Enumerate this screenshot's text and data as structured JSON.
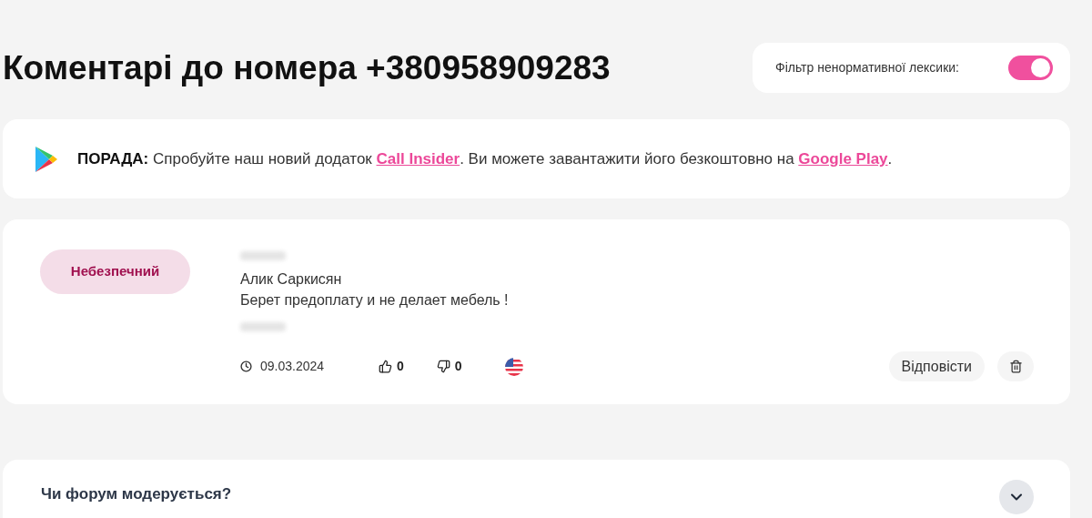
{
  "heading": "Коментарі до номера +380958909283",
  "filter": {
    "label": "Фільтр ненормативної лексики:",
    "on": true
  },
  "tip": {
    "label": "ПОРАДА:",
    "parts": [
      {
        "kind": "text",
        "text": " Спробуйте наш новий додаток "
      },
      {
        "kind": "link",
        "text": "Call Insider"
      },
      {
        "kind": "text",
        "text": ". Ви можете завантажити його безкоштовно на "
      },
      {
        "kind": "link",
        "text": "Google Play"
      },
      {
        "kind": "text",
        "text": "."
      }
    ]
  },
  "comments": [
    {
      "rating": "Небезпечний",
      "author": "Алик Саркисян",
      "text": "Берет предоплату и не делает мебель !",
      "date": "09.03.2024",
      "likes": "0",
      "dislikes": "0",
      "reply": "Відповісти"
    }
  ],
  "faq": [
    {
      "question": "Чи форум модерується?",
      "expanded": false
    }
  ]
}
